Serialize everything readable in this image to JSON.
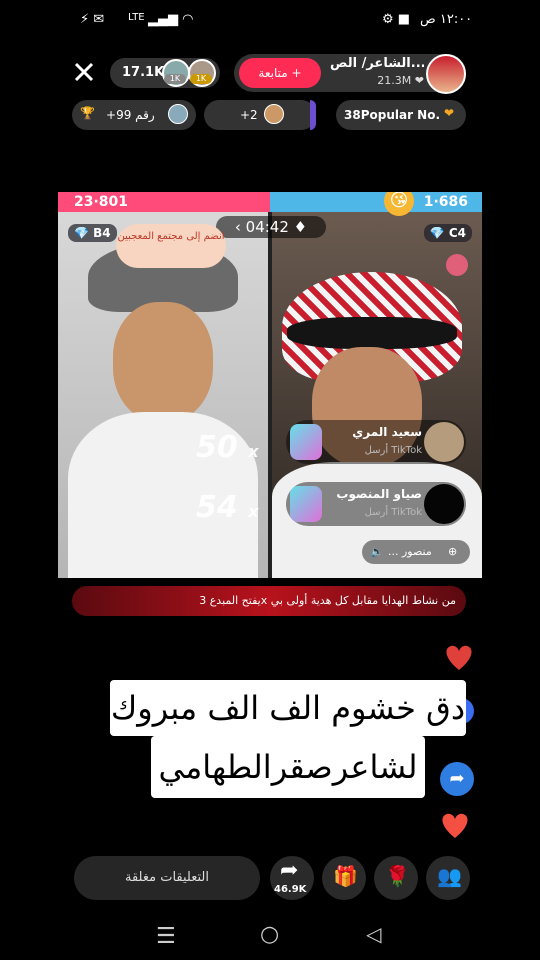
{
  "status_bar": {
    "time": "١٢:٠٠ ص",
    "network": "LTE"
  },
  "header": {
    "viewer_count": "17.1K",
    "viewer_badges": [
      "1K",
      "1K"
    ],
    "follow_label": "متابعة +",
    "host_name": "الشاعر/ الص...",
    "host_likes": "21.3M",
    "ranking_label": "رقم 99+",
    "extra_viewers": "+2",
    "popular_label": "38Popular No."
  },
  "battle": {
    "score_left": "23·801",
    "score_right": "1·686",
    "timer": "04:42",
    "badge_left": "B4",
    "badge_right": "C4",
    "cloud_text": "انضم إلى مجتمع المعجبين",
    "multiplier_1": "50",
    "multiplier_2": "54",
    "mult_suffix": "x",
    "gifts": [
      {
        "name": "سعيد المري",
        "sub": "أرسل TikTok"
      },
      {
        "name": "صياو المنصوب",
        "sub": "أرسل TikTok"
      }
    ],
    "mute_label": "منصور ..."
  },
  "promo_banner": "يفتح المبدع 3x من نشاط الهدايا مقابل كل هدية أولى بي",
  "caption": {
    "line1": "دق خشوم الف الف مبروك",
    "line2": "لشاعرصقرالطهامي"
  },
  "bottom_bar": {
    "comments_closed": "التعليقات مغلقة",
    "share_count": "46.9K"
  },
  "colors": {
    "accent": "#fe2c55",
    "score_left": "#fe4b7a",
    "score_right": "#4fb7e8"
  }
}
